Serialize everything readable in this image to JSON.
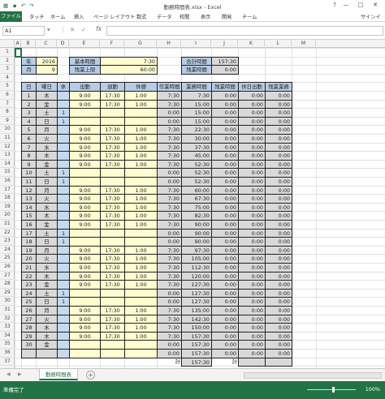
{
  "window": {
    "title": "勤務時間表.xlsx - Excel",
    "help": "?",
    "minimize": "—",
    "maximize": "□",
    "close": "✕"
  },
  "ribbon": {
    "tabs": [
      "ファイル",
      "タッチ",
      "ホーム",
      "挿入",
      "ページ レイアウト",
      "数式",
      "データ",
      "校閲",
      "表示",
      "開発",
      "チーム"
    ],
    "signin": "サインイ"
  },
  "formula_bar": {
    "name_box": "A1",
    "formula": ""
  },
  "columns": [
    "A",
    "B",
    "C",
    "D",
    "E",
    "F",
    "G",
    "H",
    "I",
    "J",
    "K",
    "L",
    "M"
  ],
  "row_numbers": [
    "1",
    "2",
    "3",
    "4",
    "5",
    "6",
    "7",
    "8",
    "9",
    "10",
    "11",
    "12",
    "13",
    "14",
    "15",
    "16",
    "17",
    "18",
    "19",
    "20",
    "21",
    "22",
    "23",
    "24",
    "25",
    "26",
    "27",
    "28",
    "29",
    "30",
    "31",
    "32",
    "33",
    "34",
    "35",
    "36",
    "37"
  ],
  "header": {
    "year_label": "年",
    "year": "2016",
    "month_label": "月",
    "month": "9",
    "base_label": "基本時間",
    "base": "7:30",
    "ot_limit_label": "残業上限",
    "ot_limit": "60:00",
    "total_label": "合計時間",
    "total": "157:30",
    "overtime_label": "残業時間",
    "overtime": "0:00"
  },
  "table": {
    "headers": [
      "日",
      "曜日",
      "休",
      "出勤",
      "退勤",
      "休憩",
      "作業時間",
      "業務時間",
      "残業時間",
      "休日出勤",
      "残業業務"
    ],
    "rows": [
      [
        "1",
        "木",
        "",
        "9:00",
        "17:30",
        "1:00",
        "7:30",
        "7:30",
        "0:00",
        "0:00",
        "0:00"
      ],
      [
        "2",
        "金",
        "",
        "9:00",
        "17:30",
        "1:00",
        "7:30",
        "15:00",
        "0:00",
        "0:00",
        "0:00"
      ],
      [
        "3",
        "土",
        "1",
        "",
        "",
        "",
        "0:00",
        "15:00",
        "0:00",
        "0:00",
        "0:00"
      ],
      [
        "4",
        "日",
        "1",
        "",
        "",
        "",
        "0:00",
        "15:00",
        "0:00",
        "0:00",
        "0:00"
      ],
      [
        "5",
        "月",
        "",
        "9:00",
        "17:30",
        "1:00",
        "7:30",
        "22:30",
        "0:00",
        "0:00",
        "0:00"
      ],
      [
        "6",
        "火",
        "",
        "9:00",
        "17:30",
        "1:00",
        "7:30",
        "30:00",
        "0:00",
        "0:00",
        "0:00"
      ],
      [
        "7",
        "水",
        "",
        "9:00",
        "17:30",
        "1:00",
        "7:30",
        "37:30",
        "0:00",
        "0:00",
        "0:00"
      ],
      [
        "8",
        "木",
        "",
        "9:00",
        "17:30",
        "1:00",
        "7:30",
        "45:00",
        "0:00",
        "0:00",
        "0:00"
      ],
      [
        "9",
        "金",
        "",
        "9:00",
        "17:30",
        "1:00",
        "7:30",
        "52:30",
        "0:00",
        "0:00",
        "0:00"
      ],
      [
        "10",
        "土",
        "1",
        "",
        "",
        "",
        "0:00",
        "52:30",
        "0:00",
        "0:00",
        "0:00"
      ],
      [
        "11",
        "日",
        "1",
        "",
        "",
        "",
        "0:00",
        "52:30",
        "0:00",
        "0:00",
        "0:00"
      ],
      [
        "12",
        "月",
        "",
        "9:00",
        "17:30",
        "1:00",
        "7:30",
        "60:00",
        "0:00",
        "0:00",
        "0:00"
      ],
      [
        "13",
        "火",
        "",
        "9:00",
        "17:30",
        "1:00",
        "7:30",
        "67:30",
        "0:00",
        "0:00",
        "0:00"
      ],
      [
        "14",
        "水",
        "",
        "9:00",
        "17:30",
        "1:00",
        "7:30",
        "75:00",
        "0:00",
        "0:00",
        "0:00"
      ],
      [
        "15",
        "木",
        "",
        "9:00",
        "17:30",
        "1:00",
        "7:30",
        "82:30",
        "0:00",
        "0:00",
        "0:00"
      ],
      [
        "16",
        "金",
        "",
        "9:00",
        "17:30",
        "1:00",
        "7:30",
        "90:00",
        "0:00",
        "0:00",
        "0:00"
      ],
      [
        "17",
        "土",
        "1",
        "",
        "",
        "",
        "0:00",
        "90:00",
        "0:00",
        "0:00",
        "0:00"
      ],
      [
        "18",
        "日",
        "1",
        "",
        "",
        "",
        "0:00",
        "90:00",
        "0:00",
        "0:00",
        "0:00"
      ],
      [
        "19",
        "月",
        "",
        "9:00",
        "17:30",
        "1:00",
        "7:30",
        "97:30",
        "0:00",
        "0:00",
        "0:00"
      ],
      [
        "20",
        "火",
        "",
        "9:00",
        "17:30",
        "1:00",
        "7:30",
        "105:00",
        "0:00",
        "0:00",
        "0:00"
      ],
      [
        "21",
        "水",
        "",
        "9:00",
        "17:30",
        "1:00",
        "7:30",
        "112:30",
        "0:00",
        "0:00",
        "0:00"
      ],
      [
        "22",
        "木",
        "",
        "9:00",
        "17:30",
        "1:00",
        "7:30",
        "120:00",
        "0:00",
        "0:00",
        "0:00"
      ],
      [
        "23",
        "金",
        "",
        "9:00",
        "17:30",
        "1:00",
        "7:30",
        "127:30",
        "0:00",
        "0:00",
        "0:00"
      ],
      [
        "24",
        "土",
        "1",
        "",
        "",
        "",
        "0:00",
        "127:30",
        "0:00",
        "0:00",
        "0:00"
      ],
      [
        "25",
        "日",
        "1",
        "",
        "",
        "",
        "0:00",
        "127:30",
        "0:00",
        "0:00",
        "0:00"
      ],
      [
        "26",
        "月",
        "",
        "9:00",
        "17:30",
        "1:00",
        "7:30",
        "135:00",
        "0:00",
        "0:00",
        "0:00"
      ],
      [
        "27",
        "火",
        "",
        "9:00",
        "17:30",
        "1:00",
        "7:30",
        "142:30",
        "0:00",
        "0:00",
        "0:00"
      ],
      [
        "28",
        "水",
        "",
        "9:00",
        "17:30",
        "1:00",
        "7:30",
        "150:00",
        "0:00",
        "0:00",
        "0:00"
      ],
      [
        "29",
        "木",
        "",
        "9:00",
        "17:30",
        "1:00",
        "7:30",
        "157:30",
        "0:00",
        "0:00",
        "0:00"
      ],
      [
        "30",
        "金",
        "",
        "",
        "",
        "",
        "0:00",
        "157:30",
        "0:00",
        "0:00",
        "0:00"
      ],
      [
        "",
        "",
        "",
        "",
        "",
        "",
        "0:00",
        "157:30",
        "0:00",
        "0:00",
        "0:00"
      ]
    ],
    "sum_label_1": "計",
    "sum_value": "157:30",
    "sum_label_2": "計"
  },
  "sheet": {
    "tab": "勤務時間表",
    "prev": "◀",
    "next": "▶",
    "add": "+"
  },
  "status": {
    "ready": "準備完了",
    "zoom": "100%"
  },
  "colors": {
    "excel_green": "#217346",
    "input_yellow": "#fffcd0",
    "header_blue": "#b8cce4",
    "weekend_blue": "#c5d9f1",
    "calc_gray": "#d9d9d9"
  }
}
